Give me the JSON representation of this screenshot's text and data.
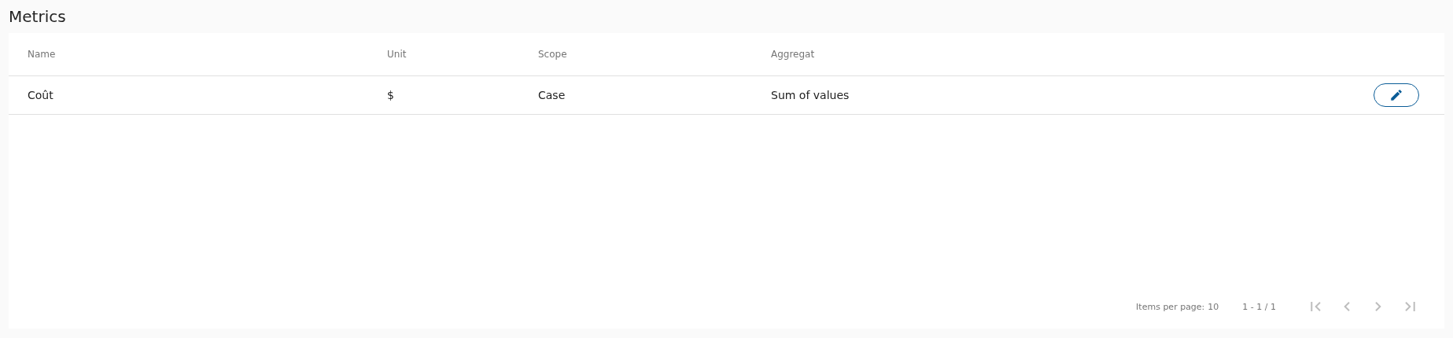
{
  "title": "Metrics",
  "table": {
    "columns": [
      "Name",
      "Unit",
      "Scope",
      "Aggregat"
    ],
    "rows": [
      {
        "cells": [
          "Coût",
          "$",
          "Case",
          "Sum of values"
        ]
      }
    ]
  },
  "paginator": {
    "items_per_page_label": "Items per page:",
    "items_per_page": "10",
    "range": "1 - 1 / 1",
    "buttons": [
      {
        "kind": "first",
        "disabled": true
      },
      {
        "kind": "previous",
        "disabled": true
      },
      {
        "kind": "next",
        "disabled": true
      },
      {
        "kind": "last",
        "disabled": true
      }
    ]
  }
}
